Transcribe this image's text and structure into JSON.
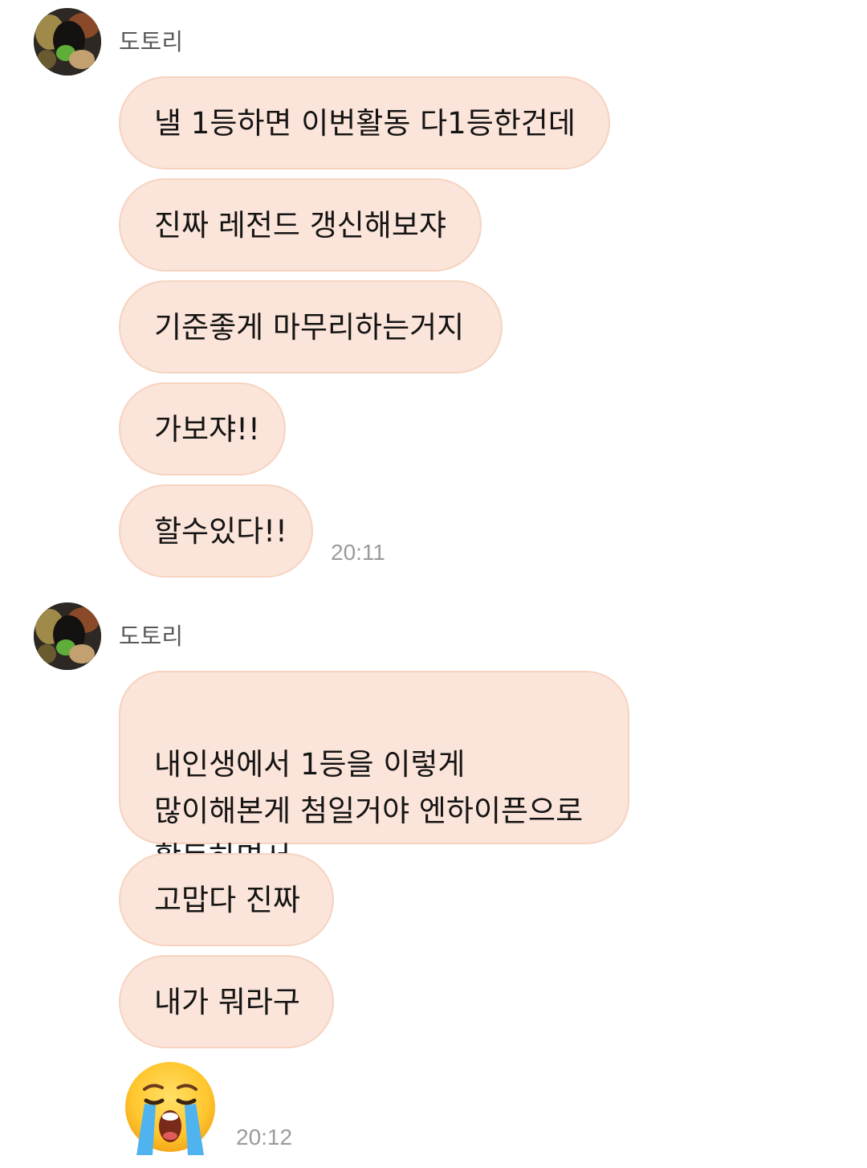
{
  "groups": [
    {
      "sender": "도토리",
      "messages": [
        "낼 1등하면 이번활동 다1등한건데",
        "진짜 레전드 갱신해보쟈",
        "기준좋게 마무리하는거지",
        "가보쟈!!",
        "할수있다!!"
      ],
      "time": "20:11"
    },
    {
      "sender": "도토리",
      "messages": [
        "내인생에서 1등을 이렇게\n많이해본게 첨일거야 엔하이픈으로\n활동하면서",
        "고맙다 진짜",
        "내가 뭐라구"
      ],
      "emoji": "loudly-crying-face-emoji",
      "time": "20:12"
    }
  ],
  "colors": {
    "bubble_bg": "#fbe4d9",
    "bubble_border": "#f6d3c0",
    "text": "#141414",
    "sender": "#5a5a5a",
    "time": "#9b9b9b"
  }
}
